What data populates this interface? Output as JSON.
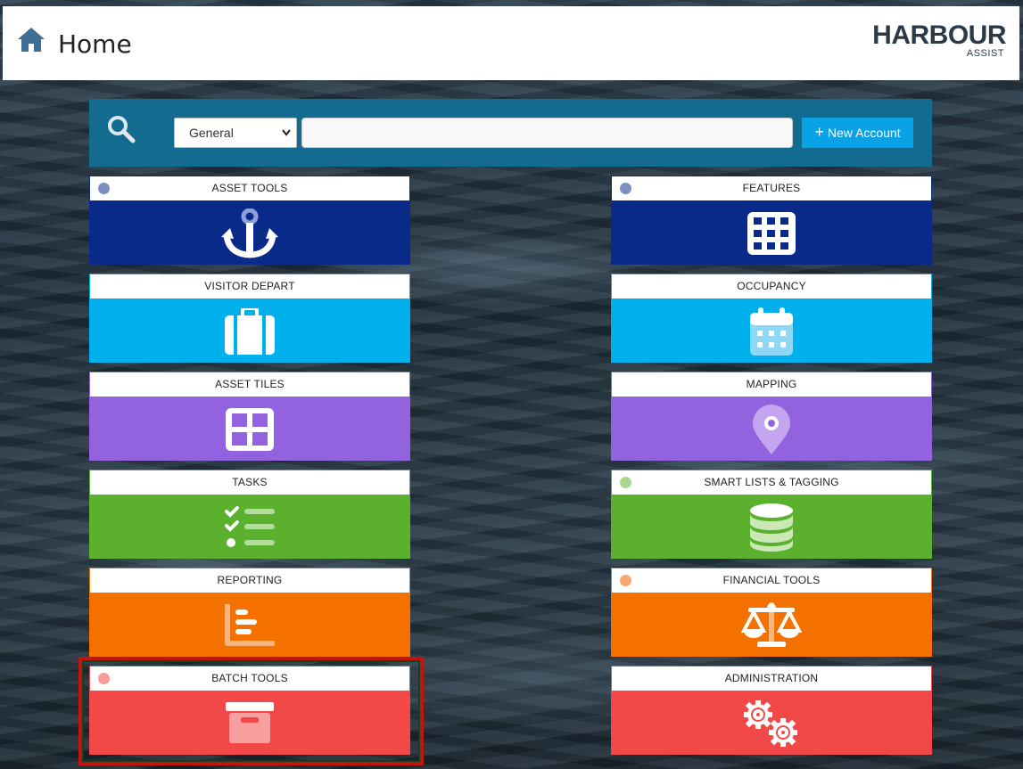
{
  "header": {
    "title": "Home",
    "logo_main": "HARBOUR",
    "logo_sub": "ASSIST"
  },
  "search": {
    "select_value": "General",
    "input_value": "",
    "new_account_label": "New Account"
  },
  "colors": {
    "navy": "#0a2a8a",
    "sky": "#00b0ec",
    "purple": "#9363df",
    "green": "#5bb02d",
    "orange": "#f47100",
    "red": "#f34848",
    "searchbar": "#136c90",
    "button": "#0aa2e6"
  },
  "tiles": [
    {
      "label": "ASSET TOOLS",
      "icon": "anchor-icon"
    },
    {
      "label": "FEATURES",
      "icon": "grid-icon"
    },
    {
      "label": "VISITOR DEPART",
      "icon": "suitcase-icon"
    },
    {
      "label": "OCCUPANCY",
      "icon": "calendar-icon"
    },
    {
      "label": "ASSET TILES",
      "icon": "tiles-icon"
    },
    {
      "label": "MAPPING",
      "icon": "map-pin-icon"
    },
    {
      "label": "TASKS",
      "icon": "checklist-icon"
    },
    {
      "label": "SMART LISTS & TAGGING",
      "icon": "database-icon"
    },
    {
      "label": "REPORTING",
      "icon": "bar-chart-icon"
    },
    {
      "label": "FINANCIAL TOOLS",
      "icon": "scales-icon"
    },
    {
      "label": "BATCH TOOLS",
      "icon": "archive-box-icon"
    },
    {
      "label": "ADMINISTRATION",
      "icon": "gears-icon"
    }
  ]
}
